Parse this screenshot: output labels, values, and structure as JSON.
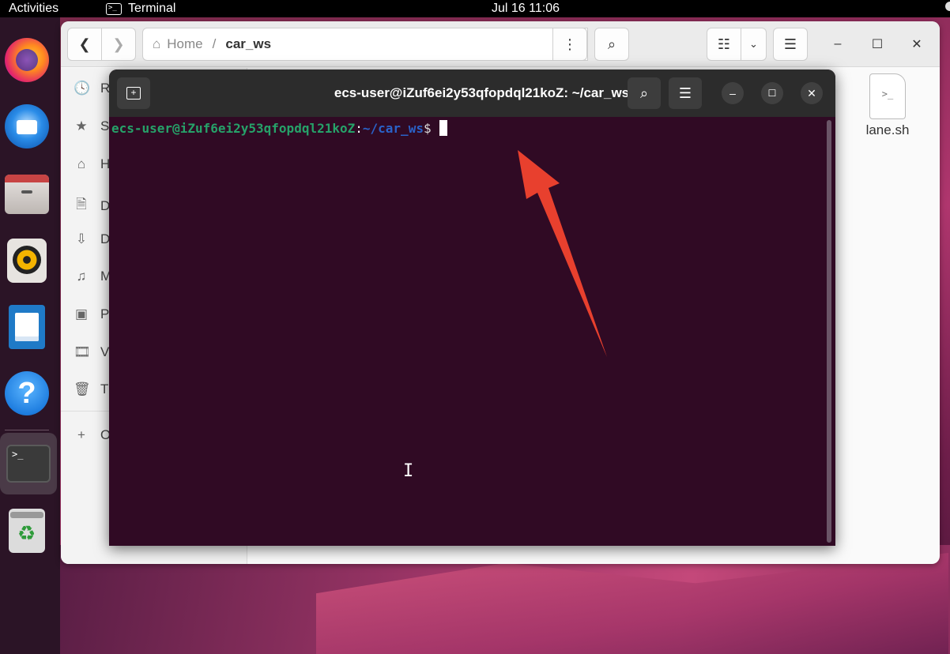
{
  "topbar": {
    "activities_label": "Activities",
    "app_name": "Terminal",
    "app_icon": "terminal-icon",
    "datetime": "Jul 16  11:06"
  },
  "dock": {
    "items": [
      {
        "name": "firefox",
        "icon": "firefox-icon"
      },
      {
        "name": "thunderbird",
        "icon": "thunderbird-icon"
      },
      {
        "name": "files",
        "icon": "files-icon"
      },
      {
        "name": "rhythmbox",
        "icon": "rhythmbox-icon"
      },
      {
        "name": "libreoffice-writer",
        "icon": "writer-icon"
      },
      {
        "name": "help",
        "icon": "help-icon",
        "glyph": "?"
      },
      {
        "name": "terminal",
        "icon": "terminal-icon",
        "glyph": ">_",
        "active": true
      },
      {
        "name": "trash",
        "icon": "trash-icon"
      }
    ]
  },
  "files_window": {
    "path": {
      "home_label": "Home",
      "separator": "/",
      "current": "car_ws"
    },
    "sidebar": {
      "items": [
        {
          "icon": "recent-icon",
          "glyph": "🕓",
          "label": "R"
        },
        {
          "icon": "star-icon",
          "glyph": "★",
          "label": "S"
        },
        {
          "icon": "home-icon",
          "glyph": "⌂",
          "label": "H"
        },
        {
          "icon": "document-icon",
          "glyph": "🗎",
          "label": "D"
        },
        {
          "icon": "download-icon",
          "glyph": "⇩",
          "label": "D"
        },
        {
          "icon": "music-icon",
          "glyph": "♫",
          "label": "M"
        },
        {
          "icon": "picture-icon",
          "glyph": "▣",
          "label": "P"
        },
        {
          "icon": "video-icon",
          "glyph": "🎞",
          "label": "V"
        },
        {
          "icon": "trash-icon",
          "glyph": "🗑",
          "label": "T"
        }
      ],
      "other": {
        "icon": "plus-icon",
        "glyph": "+",
        "label": "O"
      }
    },
    "files": [
      {
        "name": "lane.sh",
        "icon": "script-file-icon",
        "glyph": ">_"
      }
    ]
  },
  "terminal": {
    "title": "ecs-user@iZuf6ei2y53qfopdql21koZ: ~/car_ws",
    "prompt_user": "ecs-user@iZuf6ei2y53qfopdql21koZ",
    "prompt_colon": ":",
    "prompt_path": "~/car_ws",
    "prompt_symbol": "$"
  },
  "annotation": {
    "color": "#e8402e",
    "icon": "red-arrow-icon"
  }
}
